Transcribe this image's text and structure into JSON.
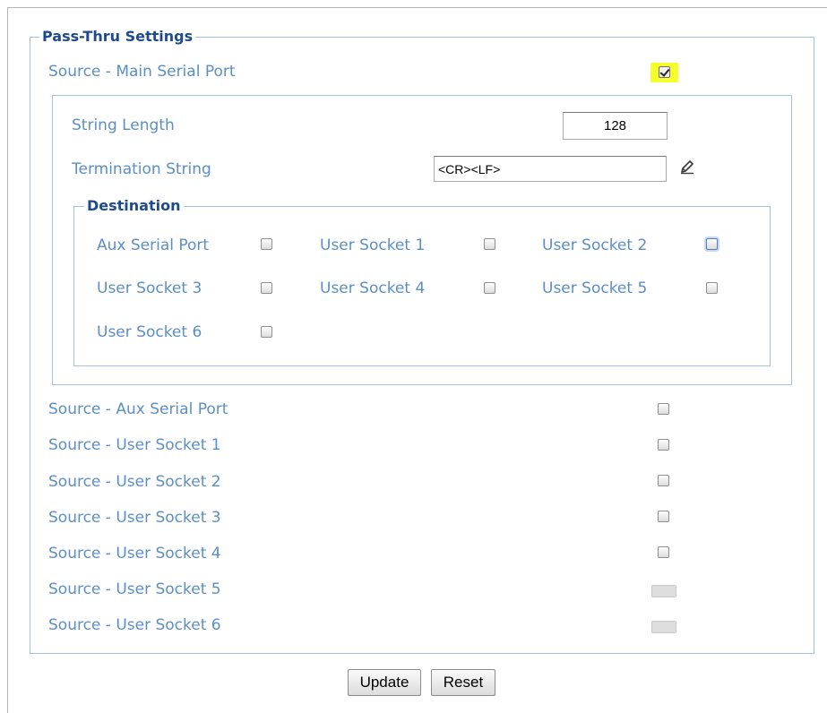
{
  "fieldset_title": "Pass-Thru Settings",
  "main_source": {
    "label": "Source - Main Serial Port",
    "checked": true
  },
  "string_length": {
    "label": "String Length",
    "value": "128"
  },
  "termination_string": {
    "label": "Termination String",
    "value": "<CR><LF>",
    "edit_icon": "pencil-icon"
  },
  "destination": {
    "title": "Destination",
    "items": [
      {
        "label": "Aux Serial Port",
        "checked": false
      },
      {
        "label": "User Socket 1",
        "checked": false
      },
      {
        "label": "User Socket 2",
        "checked": false,
        "focused": true
      },
      {
        "label": "User Socket 3",
        "checked": false
      },
      {
        "label": "User Socket 4",
        "checked": false
      },
      {
        "label": "User Socket 5",
        "checked": false
      },
      {
        "label": "User Socket 6",
        "checked": false
      }
    ]
  },
  "sources": [
    {
      "label": "Source - Aux Serial Port",
      "checked": false,
      "disabled": false
    },
    {
      "label": "Source - User Socket 1",
      "checked": false,
      "disabled": false
    },
    {
      "label": "Source - User Socket 2",
      "checked": false,
      "disabled": false
    },
    {
      "label": "Source - User Socket 3",
      "checked": false,
      "disabled": false
    },
    {
      "label": "Source - User Socket 4",
      "checked": false,
      "disabled": false
    },
    {
      "label": "Source - User Socket 5",
      "checked": false,
      "disabled": true
    },
    {
      "label": "Source - User Socket 6",
      "checked": false,
      "disabled": true
    }
  ],
  "buttons": {
    "update": "Update",
    "reset": "Reset"
  },
  "colors": {
    "label": "#5b8fc4",
    "legend": "#1f4b8e",
    "border": "#9ec3e6",
    "highlight": "#f5ff2e"
  }
}
